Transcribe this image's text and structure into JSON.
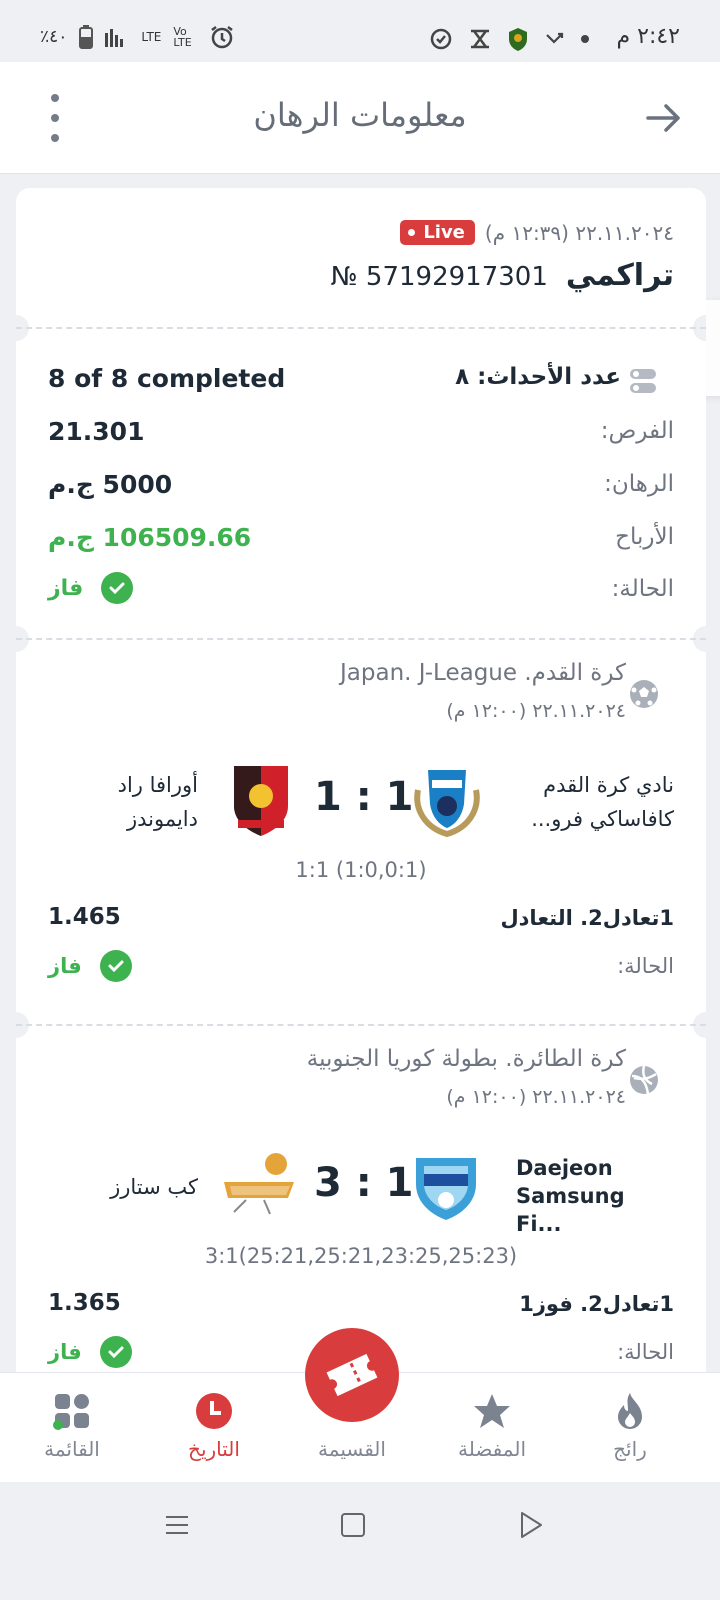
{
  "status_bar": {
    "time": "٢:٤٢ م",
    "battery": "٪٤٠",
    "lte": "LTE",
    "volte": "Vo LTE"
  },
  "header": {
    "title": "معلومات الرهان"
  },
  "bet": {
    "datetime": "٢٢.١١.٢٠٢٤ (١٢:٣٩ م)",
    "live_label": "Live",
    "type": "تراكمي",
    "number": "57192917301 №",
    "events_label": "عدد الأحداث: ٨",
    "completed": "8 of 8 completed",
    "odds_label": "الفرص:",
    "odds_value": "21.301",
    "stake_label": "الرهان:",
    "stake_value": "5000 ج.م",
    "winnings_label": "الأرباح",
    "winnings_value": "106509.66 ج.م",
    "status_label": "الحالة:",
    "status_value": "فاز"
  },
  "events": [
    {
      "sport_league": "كرة القدم. Japan. J-League",
      "datetime": "٢٢.١١.٢٠٢٤ (١٢:٠٠ م)",
      "home_team": "نادي كرة القدم كافاساكي فرو...",
      "away_team": "أورافا راد دايموندز",
      "score": "1 : 1",
      "score_details": "1:1 (1:0,0:1)",
      "market": "1تعادل2. التعادل",
      "odds": "1.465",
      "status_label": "الحالة:",
      "status_value": "فاز"
    },
    {
      "sport_league": "كرة الطائرة. بطولة كوريا الجنوبية",
      "datetime": "٢٢.١١.٢٠٢٤ (١٢:٠٠ م)",
      "home_team": "Daejeon Samsung Fi...",
      "away_team": "كب ستارز",
      "score": "3 : 1",
      "score_details": "3:1(25:21,25:21,23:25,25:23)",
      "market": "1تعادل2. فوز1",
      "odds": "1.365",
      "status_label": "الحالة:",
      "status_value": "فاز"
    }
  ],
  "bottom_nav": {
    "items": [
      {
        "label": "رائج"
      },
      {
        "label": "المفضلة"
      },
      {
        "label": "القسيمة"
      },
      {
        "label": "التاريخ"
      },
      {
        "label": "القائمة"
      }
    ]
  },
  "colors": {
    "accent": "#d93c3c",
    "success": "#3eb24f",
    "text": "#1f2a37",
    "muted": "#6e7480"
  },
  "icons": [
    "back-arrow-icon",
    "more-vert-icon",
    "phone-icon",
    "settings-toggle-icon",
    "soccer-ball-icon",
    "volleyball-icon",
    "check-circle-icon",
    "fire-icon",
    "star-icon",
    "ticket-icon",
    "clock-icon",
    "grid-icon"
  ]
}
